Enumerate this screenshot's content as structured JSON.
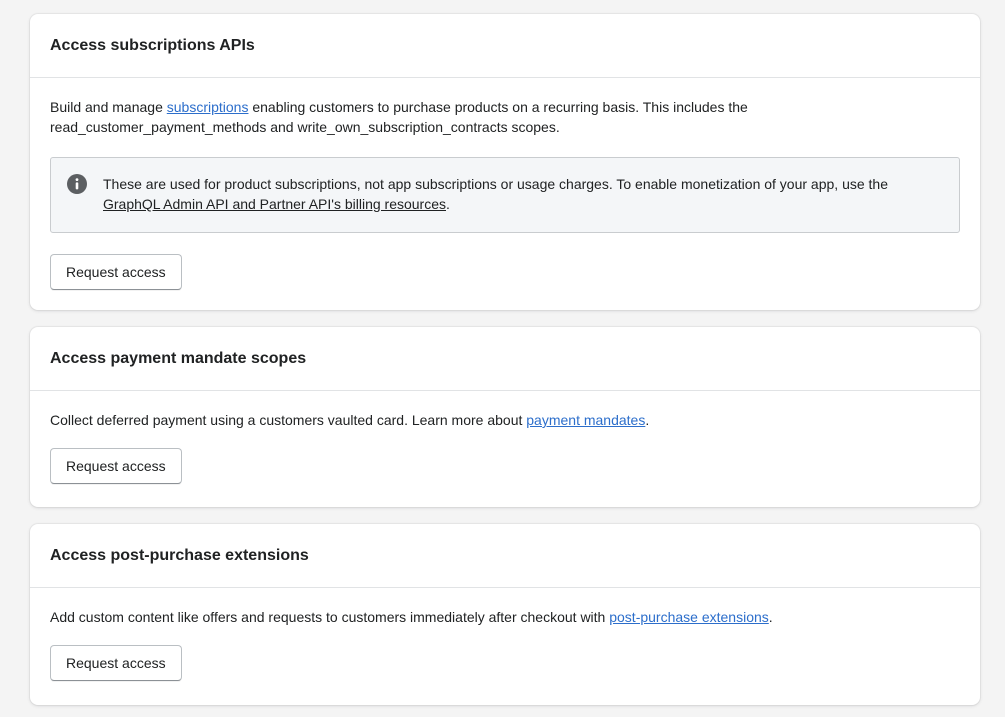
{
  "colors": {
    "page_background": "#f4f4f4",
    "card_background": "#ffffff",
    "link": "#2c6ecb",
    "text": "#202223",
    "banner_background": "#f4f6f8"
  },
  "cards": [
    {
      "title": "Access subscriptions APIs",
      "description": {
        "before_link": "Build and manage ",
        "link": "subscriptions",
        "after_link": " enabling customers to purchase products on a recurring basis. This includes the read_customer_payment_methods and write_own_subscription_contracts scopes."
      },
      "banner": {
        "icon": "info-icon",
        "text_before_link": "These are used for product subscriptions, not app subscriptions or usage charges. To enable monetization of your app, use the ",
        "link": "GraphQL Admin API and Partner API's billing resources",
        "text_after_link": "."
      },
      "button_label": "Request access"
    },
    {
      "title": "Access payment mandate scopes",
      "description": {
        "before_link": "Collect deferred payment using a customers vaulted card. Learn more about ",
        "link": "payment mandates",
        "after_link": "."
      },
      "button_label": "Request access"
    },
    {
      "title": "Access post-purchase extensions",
      "description": {
        "before_link": "Add custom content like offers and requests to customers immediately after checkout with ",
        "link": "post-purchase extensions",
        "after_link": "."
      },
      "button_label": "Request access"
    }
  ]
}
